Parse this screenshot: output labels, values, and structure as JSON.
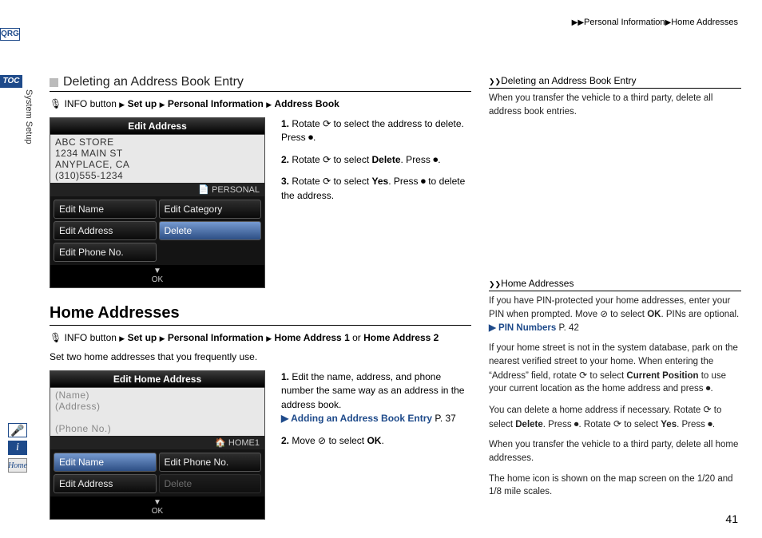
{
  "breadcrumb": {
    "a": "Personal Information",
    "b": "Home Addresses"
  },
  "tabs": {
    "qrg": "QRG",
    "toc": "TOC",
    "side_label": "System Setup",
    "home_label": "Home"
  },
  "section1": {
    "title": "Deleting an Address Book Entry",
    "path_prefix": "INFO button",
    "path": [
      "Set up",
      "Personal Information",
      "Address Book"
    ],
    "screen": {
      "title": "Edit Address",
      "line1": "ABC STORE",
      "line2": "1234 MAIN ST",
      "line3": "ANYPLACE, CA",
      "line4": "(310)555-1234",
      "category": "PERSONAL",
      "btn1": "Edit Name",
      "btn2": "Edit Category",
      "btn3": "Edit Address",
      "btn4": "Delete",
      "btn5": "Edit Phone No.",
      "ok": "OK"
    },
    "step1a": "Rotate ",
    "step1b": " to select the address to delete. Press ",
    "step1c": ".",
    "step2a": "Rotate ",
    "step2b": " to select ",
    "step2c": "Delete",
    "step2d": ". Press ",
    "step2e": ".",
    "step3a": "Rotate ",
    "step3b": " to select ",
    "step3c": "Yes",
    "step3d": ". Press ",
    "step3e": " to delete the address."
  },
  "section2": {
    "title": "Home Addresses",
    "path_prefix": "INFO button",
    "path": [
      "Set up",
      "Personal Information"
    ],
    "path_tail_a": "Home Address 1",
    "path_tail_or": " or ",
    "path_tail_b": "Home Address 2",
    "intro": "Set two home addresses that you frequently use.",
    "screen": {
      "title": "Edit Home Address",
      "line1": "(Name)",
      "line2": "(Address)",
      "line4": "(Phone No.)",
      "category": "HOME1",
      "btn1": "Edit Name",
      "btn2": "Edit Phone No.",
      "btn3": "Edit Address",
      "btn4": "Delete",
      "ok": "OK"
    },
    "step1": "Edit the name, address, and phone number the same way as an address in the address book.",
    "link1": "Adding an Address Book Entry",
    "link1_page": "P. 37",
    "step2a": "Move ",
    "step2b": " to select ",
    "step2c": "OK",
    "step2d": "."
  },
  "notes": {
    "n1_title": "Deleting an Address Book Entry",
    "n1_p1": "When you transfer the vehicle to a third party, delete all address book entries.",
    "n2_title": "Home Addresses",
    "n2_p1a": "If you have PIN-protected your home addresses, enter your PIN when prompted. Move ",
    "n2_p1b": " to select ",
    "n2_p1c": "OK",
    "n2_p1d": ". PINs are optional.",
    "n2_link": "PIN Numbers",
    "n2_link_page": "P. 42",
    "n2_p2a": "If your home street is not in the system database, park on the nearest verified street to your home. When entering the “Address” field, rotate ",
    "n2_p2b": " to select ",
    "n2_p2c": "Current Position",
    "n2_p2d": " to use your current location as the home address and press ",
    "n2_p2e": ".",
    "n2_p3a": "You can delete a home address if necessary. Rotate ",
    "n2_p3b": " to select ",
    "n2_p3c": "Delete",
    "n2_p3d": ". Press ",
    "n2_p3e": ". Rotate ",
    "n2_p3f": " to select ",
    "n2_p3g": "Yes",
    "n2_p3h": ". Press ",
    "n2_p3i": ".",
    "n2_p4": "When you transfer the vehicle to a third party, delete all home addresses.",
    "n2_p5": "The home icon is shown on the map screen on the 1/20 and 1/8 mile scales."
  },
  "page_number": "41"
}
